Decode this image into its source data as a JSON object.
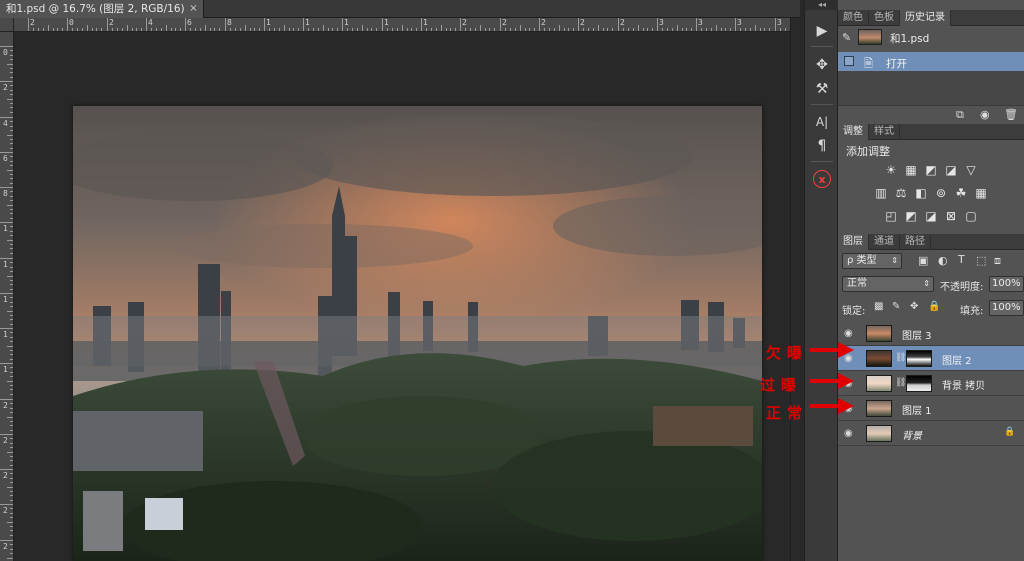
{
  "document": {
    "tab_title": "和1.psd @ 16.7% (图层 2, RGB/16)",
    "close_glyph": "×"
  },
  "rulers": {
    "top_labels": [
      "2",
      "0",
      "2",
      "4",
      "6",
      "8",
      "1",
      "1",
      "1",
      "1",
      "1",
      "2",
      "2",
      "2",
      "2",
      "2",
      "3",
      "3",
      "3",
      "3"
    ],
    "left_labels": [
      "0",
      "2",
      "4",
      "6",
      "8",
      "1",
      "1",
      "1",
      "1",
      "1",
      "2",
      "2",
      "2",
      "2",
      "2"
    ]
  },
  "tools": {
    "collapse_glyph": "◂◂",
    "items": [
      {
        "name": "play-icon",
        "glyph": "▶"
      },
      {
        "name": "brush-presets-icon",
        "glyph": "✥"
      },
      {
        "name": "tool-presets-icon",
        "glyph": "⚒"
      },
      {
        "name": "character-icon",
        "glyph": "A|"
      },
      {
        "name": "paragraph-icon",
        "glyph": "¶"
      },
      {
        "name": "x-plugin-icon",
        "glyph": "x"
      }
    ]
  },
  "history_panel": {
    "tabs": [
      {
        "label": "颜色",
        "active": false
      },
      {
        "label": "色板",
        "active": false
      },
      {
        "label": "历史记录",
        "active": true
      }
    ],
    "snapshot_name": "和1.psd",
    "states": [
      {
        "label": "打开",
        "selected": true
      }
    ]
  },
  "adjustments_panel": {
    "tabs": [
      {
        "label": "调整",
        "active": true
      },
      {
        "label": "样式",
        "active": false
      }
    ],
    "heading": "添加调整",
    "rows": [
      [
        "☀",
        "▦",
        "◩",
        "◪",
        "▽"
      ],
      [
        "▥",
        "⚖",
        "◧",
        "⊚",
        "☘",
        "▦"
      ],
      [
        "◰",
        "◩",
        "◪",
        "⊠",
        "▢"
      ]
    ]
  },
  "layers_panel": {
    "tabs": [
      {
        "label": "图层",
        "active": true
      },
      {
        "label": "通道",
        "active": false
      },
      {
        "label": "路径",
        "active": false
      }
    ],
    "filter_label": "ρ 类型",
    "blend_mode": "正常",
    "opacity_label": "不透明度:",
    "opacity_value": "100%",
    "lock_label": "锁定:",
    "fill_label": "填充:",
    "fill_value": "100%",
    "layers": [
      {
        "name": "图层 3",
        "selected": false,
        "has_mask": false,
        "locked": false
      },
      {
        "name": "图层 2",
        "selected": true,
        "has_mask": true,
        "locked": false
      },
      {
        "name": "背景 拷贝",
        "selected": false,
        "has_mask": true,
        "locked": false
      },
      {
        "name": "图层 1",
        "selected": false,
        "has_mask": false,
        "locked": false
      },
      {
        "name": "背景",
        "selected": false,
        "has_mask": false,
        "locked": true
      }
    ]
  },
  "annotations": [
    {
      "text": "欠曝"
    },
    {
      "text": "过曝"
    },
    {
      "text": "正常"
    }
  ],
  "colors": {
    "selection": "#6f8fb8",
    "annotation": "#e00000",
    "panel": "#535353"
  }
}
